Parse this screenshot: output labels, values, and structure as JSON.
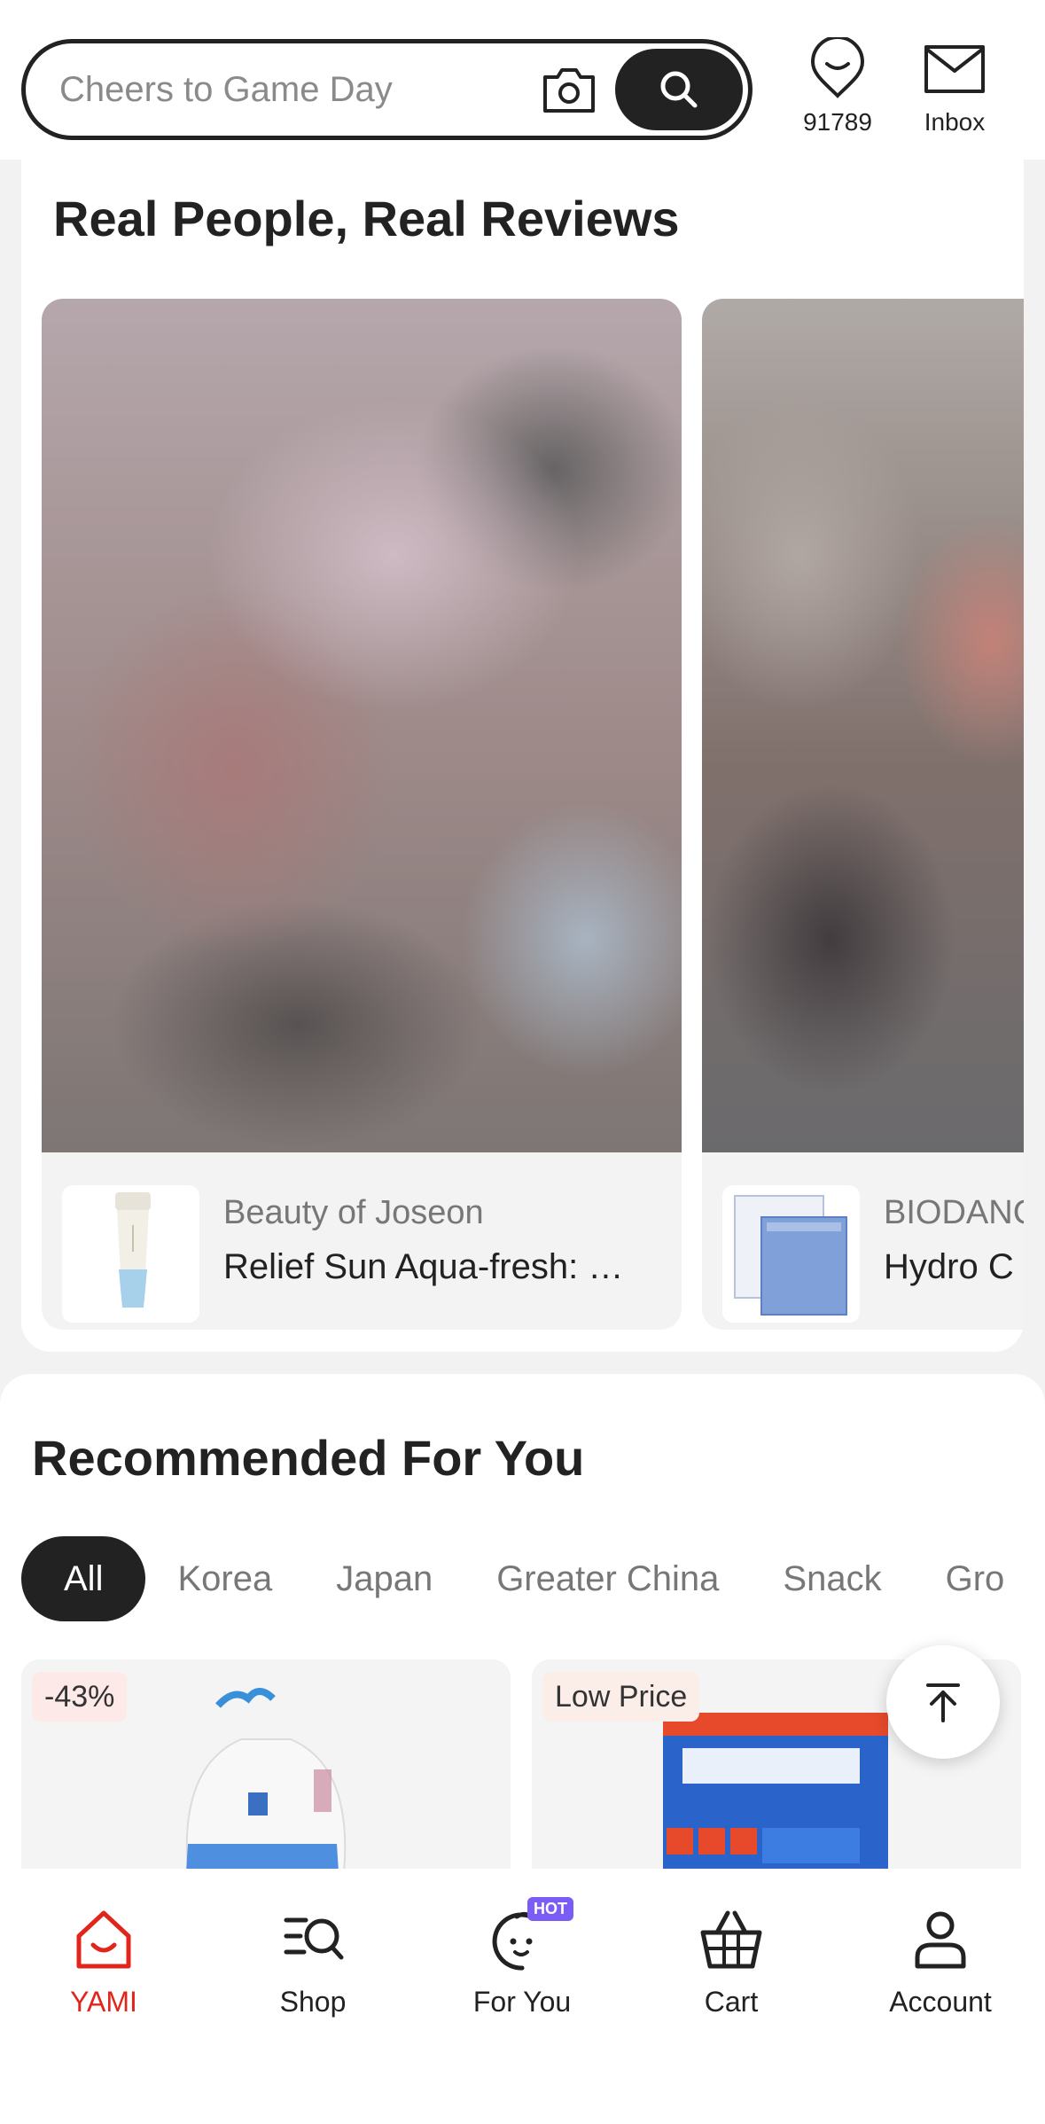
{
  "search": {
    "placeholder": "Cheers to Game Day"
  },
  "header": {
    "points_value": "91789",
    "inbox_label": "Inbox"
  },
  "reviews": {
    "title": "Real People, Real Reviews",
    "cards": [
      {
        "brand": "Beauty of Joseon",
        "product": "Relief Sun Aqua-fresh: …"
      },
      {
        "brand": "BIODANC",
        "product": "Hydro C"
      }
    ]
  },
  "recommended": {
    "title": "Recommended For You",
    "tabs": [
      "All",
      "Korea",
      "Japan",
      "Greater China",
      "Snack",
      "Gro"
    ],
    "products": [
      {
        "badge": "-43%"
      },
      {
        "badge": "Low Price"
      }
    ]
  },
  "bottom_nav": {
    "items": [
      {
        "label": "YAMI",
        "icon": "home-icon"
      },
      {
        "label": "Shop",
        "icon": "shop-search-icon"
      },
      {
        "label": "For You",
        "icon": "for-you-face-icon",
        "badge": "HOT"
      },
      {
        "label": "Cart",
        "icon": "basket-icon"
      },
      {
        "label": "Account",
        "icon": "person-icon"
      }
    ]
  },
  "colors": {
    "accent_red": "#e1251b",
    "dark": "#222222",
    "hot_badge": "#7b5cf5"
  }
}
